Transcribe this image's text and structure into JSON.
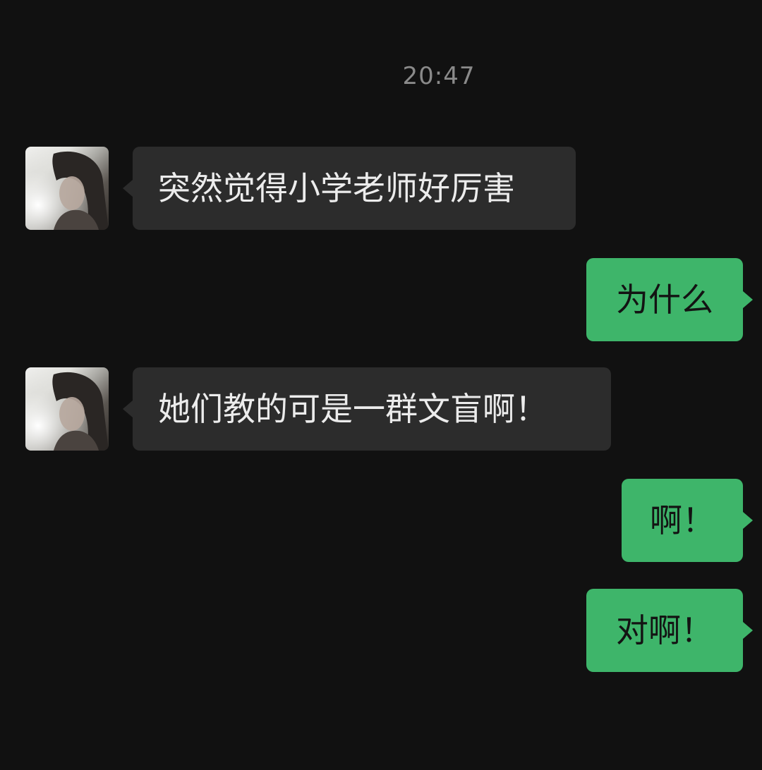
{
  "chat": {
    "timestamp": "20:47",
    "messages": [
      {
        "sender": "other",
        "text": "突然觉得小学老师好厉害"
      },
      {
        "sender": "me",
        "text": "为什么"
      },
      {
        "sender": "other",
        "text": "她们教的可是一群文盲啊！"
      },
      {
        "sender": "me",
        "text": "啊！"
      },
      {
        "sender": "me",
        "text": "对啊！"
      }
    ]
  },
  "colors": {
    "background": "#111111",
    "incoming_bubble": "#2c2c2c",
    "outgoing_bubble": "#3eb56a",
    "timestamp_text": "#8a8a8a"
  },
  "icons": {
    "avatar": "contact-avatar-photo"
  }
}
